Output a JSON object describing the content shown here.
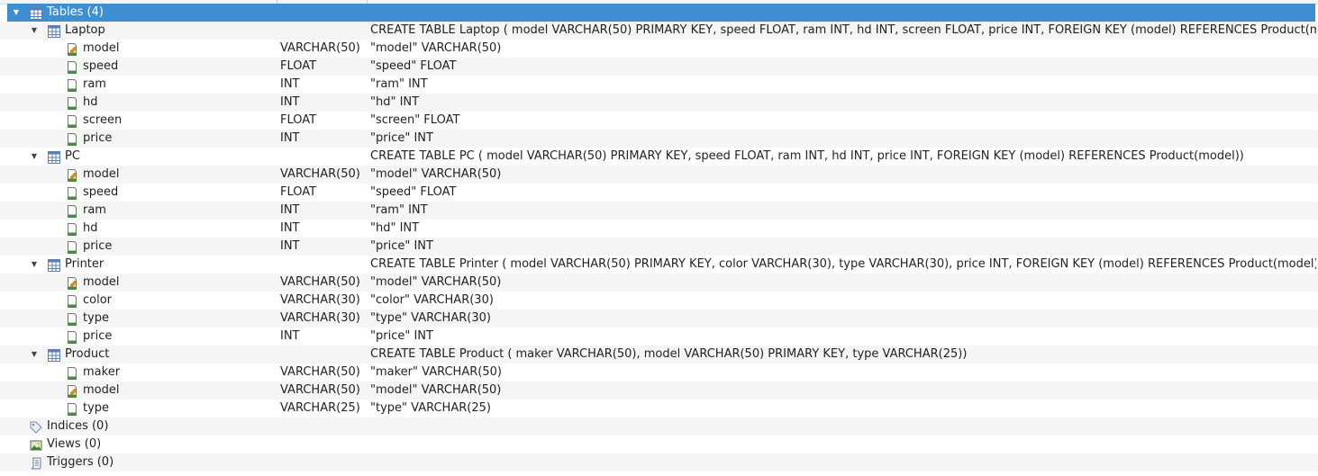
{
  "colors": {
    "selection": "#3d8fd1",
    "alt_row": "#f5f5f5",
    "table_icon": "#5b7fb5",
    "column_icon": "#3f8f3f",
    "key_badge": "#e0a020"
  },
  "root": {
    "tables": {
      "label": "Tables (4)",
      "icon": "table-grid-icon",
      "items": [
        {
          "name": "Laptop",
          "schema": "CREATE TABLE Laptop ( model VARCHAR(50) PRIMARY KEY, speed FLOAT, ram INT, hd INT, screen FLOAT, price INT, FOREIGN KEY (model) REFERENCES Product(model))",
          "columns": [
            {
              "name": "model",
              "type": "VARCHAR(50)",
              "schema": "\"model\" VARCHAR(50)",
              "key": true
            },
            {
              "name": "speed",
              "type": "FLOAT",
              "schema": "\"speed\" FLOAT",
              "key": false
            },
            {
              "name": "ram",
              "type": "INT",
              "schema": "\"ram\" INT",
              "key": false
            },
            {
              "name": "hd",
              "type": "INT",
              "schema": "\"hd\" INT",
              "key": false
            },
            {
              "name": "screen",
              "type": "FLOAT",
              "schema": "\"screen\" FLOAT",
              "key": false
            },
            {
              "name": "price",
              "type": "INT",
              "schema": "\"price\" INT",
              "key": false
            }
          ]
        },
        {
          "name": "PC",
          "schema": "CREATE TABLE PC ( model VARCHAR(50) PRIMARY KEY, speed FLOAT, ram INT, hd INT, price INT, FOREIGN KEY (model) REFERENCES Product(model))",
          "columns": [
            {
              "name": "model",
              "type": "VARCHAR(50)",
              "schema": "\"model\" VARCHAR(50)",
              "key": true
            },
            {
              "name": "speed",
              "type": "FLOAT",
              "schema": "\"speed\" FLOAT",
              "key": false
            },
            {
              "name": "ram",
              "type": "INT",
              "schema": "\"ram\" INT",
              "key": false
            },
            {
              "name": "hd",
              "type": "INT",
              "schema": "\"hd\" INT",
              "key": false
            },
            {
              "name": "price",
              "type": "INT",
              "schema": "\"price\" INT",
              "key": false
            }
          ]
        },
        {
          "name": "Printer",
          "schema": "CREATE TABLE Printer ( model VARCHAR(50) PRIMARY KEY, color VARCHAR(30), type VARCHAR(30), price INT, FOREIGN KEY (model) REFERENCES Product(model))",
          "columns": [
            {
              "name": "model",
              "type": "VARCHAR(50)",
              "schema": "\"model\" VARCHAR(50)",
              "key": true
            },
            {
              "name": "color",
              "type": "VARCHAR(30)",
              "schema": "\"color\" VARCHAR(30)",
              "key": false
            },
            {
              "name": "type",
              "type": "VARCHAR(30)",
              "schema": "\"type\" VARCHAR(30)",
              "key": false
            },
            {
              "name": "price",
              "type": "INT",
              "schema": "\"price\" INT",
              "key": false
            }
          ]
        },
        {
          "name": "Product",
          "schema": "CREATE TABLE Product ( maker VARCHAR(50), model VARCHAR(50) PRIMARY KEY, type VARCHAR(25))",
          "columns": [
            {
              "name": "maker",
              "type": "VARCHAR(50)",
              "schema": "\"maker\" VARCHAR(50)",
              "key": false
            },
            {
              "name": "model",
              "type": "VARCHAR(50)",
              "schema": "\"model\" VARCHAR(50)",
              "key": true
            },
            {
              "name": "type",
              "type": "VARCHAR(25)",
              "schema": "\"type\" VARCHAR(25)",
              "key": false
            }
          ]
        }
      ]
    },
    "indices": {
      "label": "Indices (0)",
      "icon": "tag-icon"
    },
    "views": {
      "label": "Views (0)",
      "icon": "view-image-icon"
    },
    "triggers": {
      "label": "Triggers (0)",
      "icon": "scroll-icon"
    }
  }
}
